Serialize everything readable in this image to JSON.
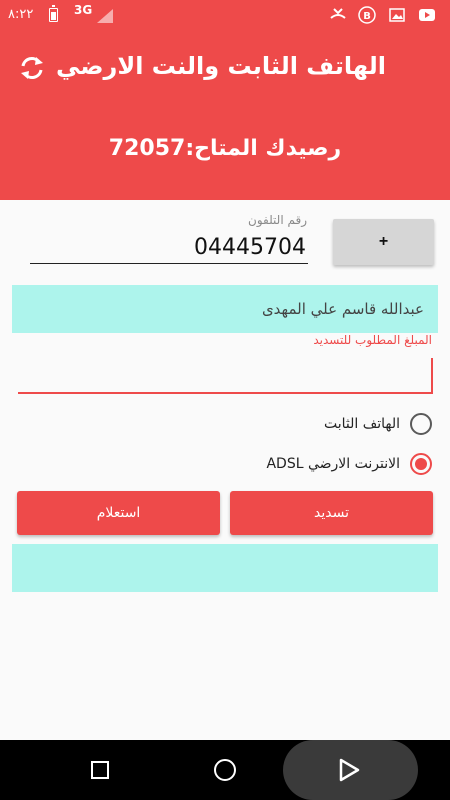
{
  "status_bar": {
    "time": "٨:٢٢",
    "network": "3G",
    "icons": [
      "battery-icon",
      "signal-icon",
      "missed-call-icon",
      "b-app-icon",
      "image-icon",
      "youtube-icon"
    ]
  },
  "header": {
    "title": "الهاتف الثابت والنت الارضي",
    "balance_label": "رصيدك المتاح:",
    "balance_value": "72057",
    "refresh_icon": "refresh-icon"
  },
  "form": {
    "phone_label": "رقم التلفون",
    "phone_value": "04445704",
    "add_button_label": "+",
    "customer_name": "عبدالله قاسم علي المهدى",
    "amount_label": "المبلغ المطلوب للتسديد",
    "amount_value": "",
    "radio_options": [
      {
        "label": "الهاتف الثابت",
        "checked": false
      },
      {
        "label": "الانترنت الارضي ADSL",
        "checked": true
      }
    ],
    "pay_button_label": "تسديد",
    "inquiry_button_label": "استعلام",
    "result_text": ""
  },
  "colors": {
    "accent": "#ee4a4a",
    "info_box": "#adf4ec",
    "nav_bar": "#000000"
  },
  "nav": {
    "icons": [
      "recent-apps-icon",
      "home-icon",
      "back-icon"
    ]
  }
}
